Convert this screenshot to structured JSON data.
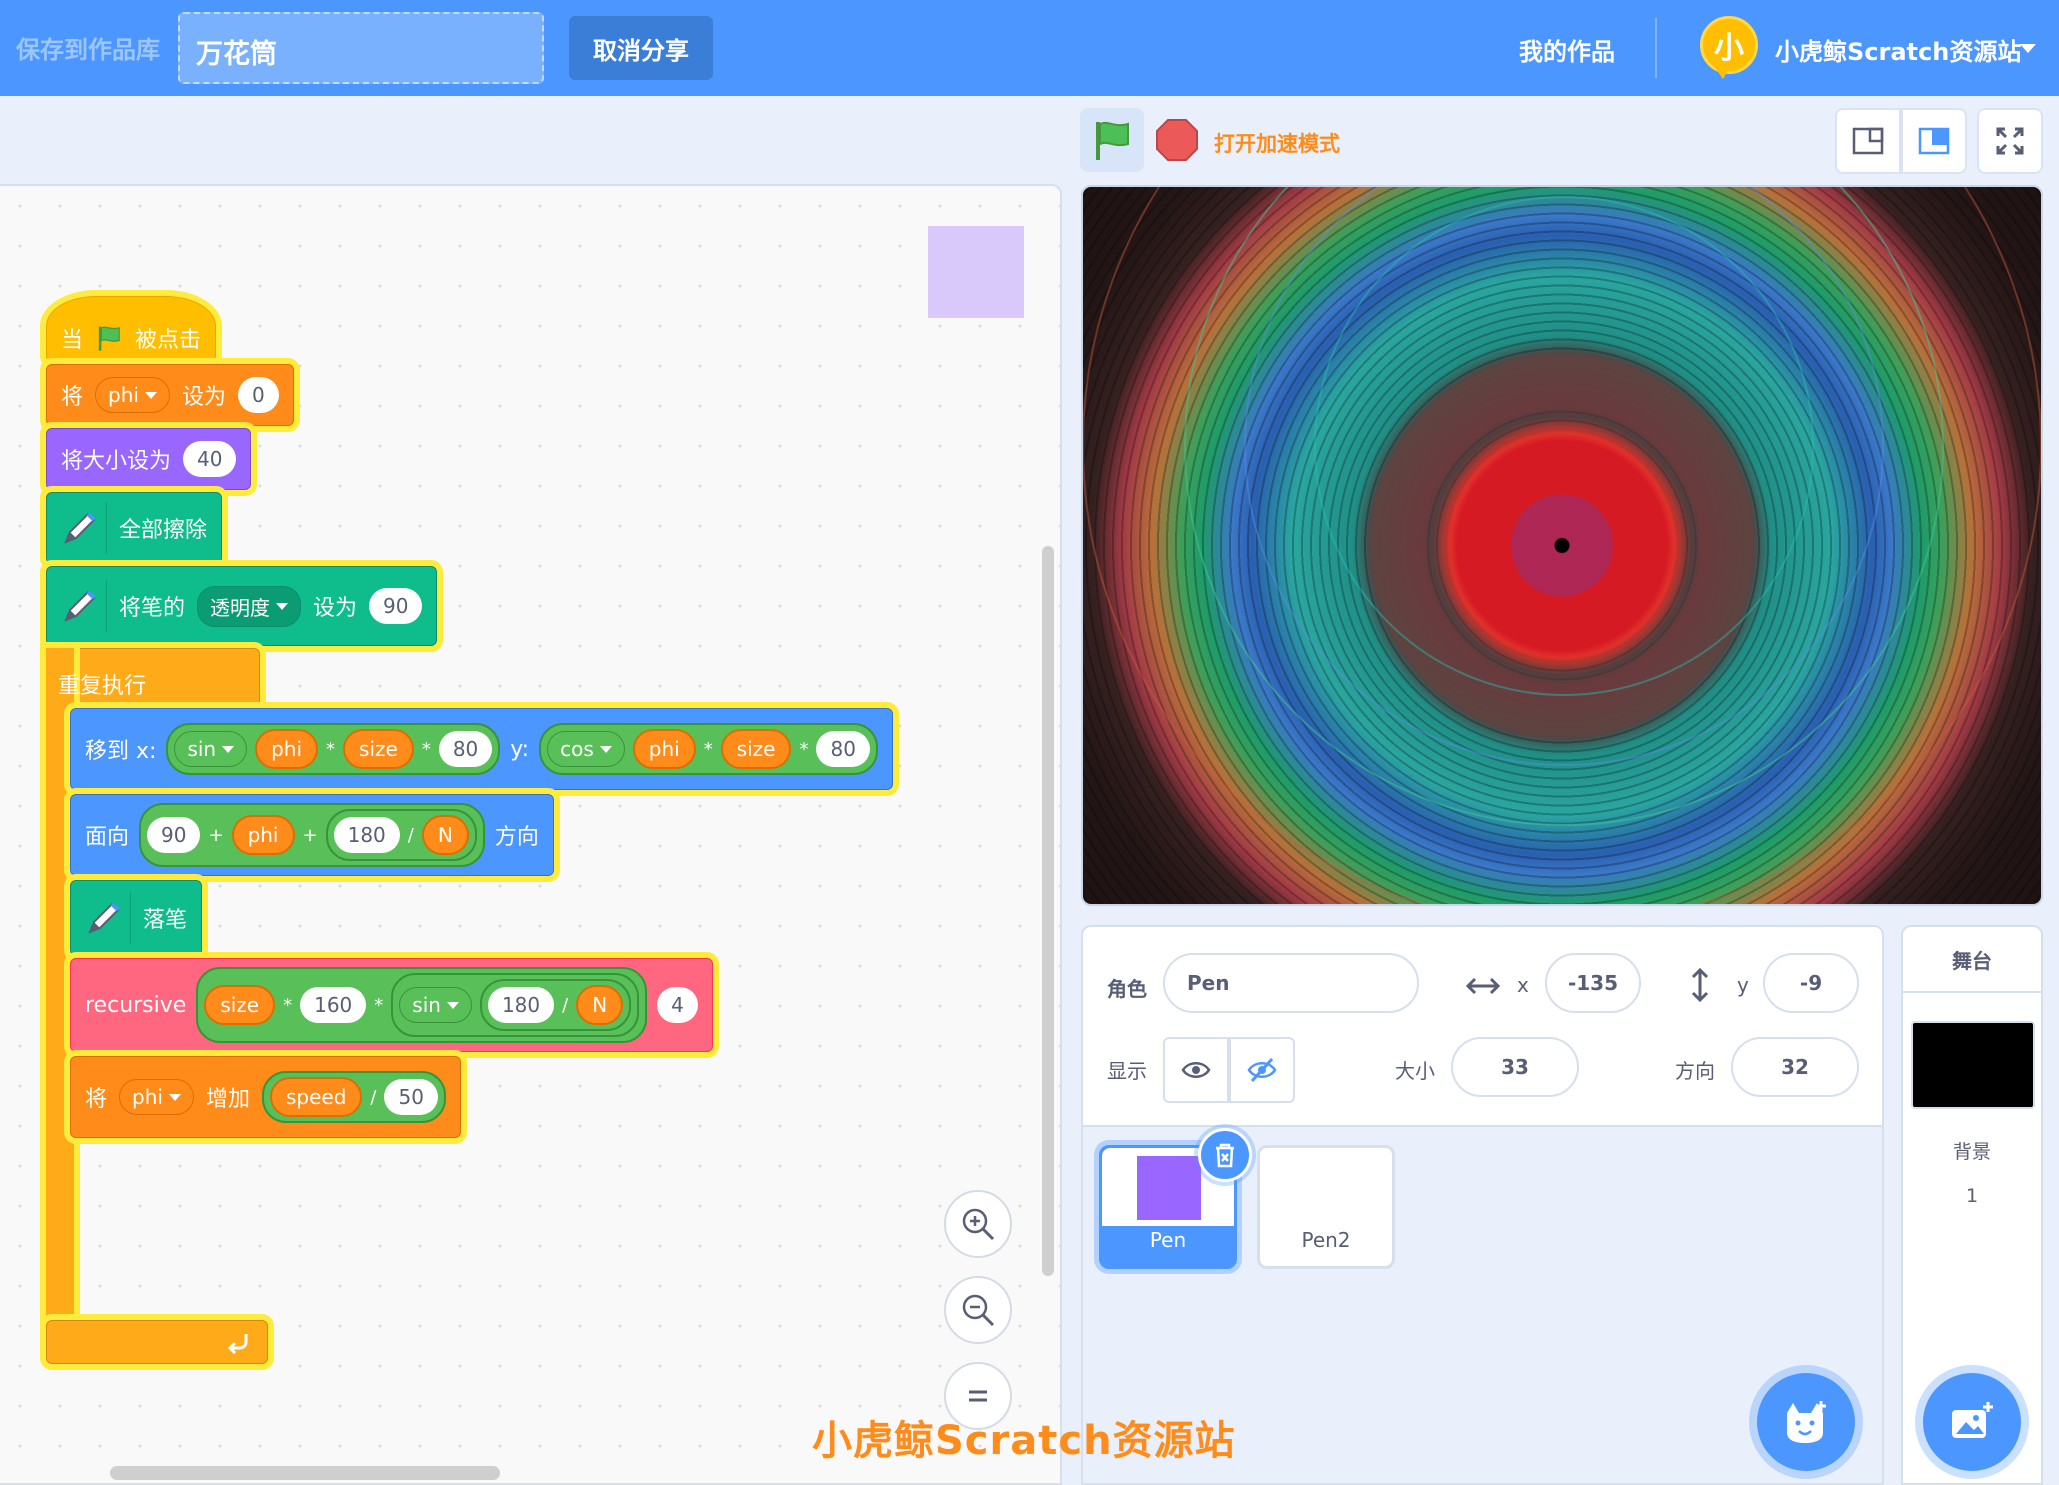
{
  "menu": {
    "save_to_library": "保存到作品库",
    "project_title": "万花筒",
    "unshare": "取消分享",
    "my_works": "我的作品",
    "avatar_char": "小",
    "user_name": "小虎鲸Scratch资源站"
  },
  "stage_header": {
    "turbo": "打开加速模式"
  },
  "blocks": {
    "when_flag_prefix": "当",
    "when_flag_suffix": "被点击",
    "set_var": {
      "label": "将",
      "var": "phi",
      "to": "设为",
      "value": "0"
    },
    "set_size": {
      "label": "将大小设为",
      "value": "40"
    },
    "erase_all": "全部擦除",
    "set_pen": {
      "label": "将笔的",
      "param": "透明度",
      "to": "设为",
      "value": "90"
    },
    "forever": "重复执行",
    "goto": {
      "label": "移到 x:",
      "fn1": "sin",
      "var1": "phi",
      "mul1": "*",
      "size1": "size",
      "mul2": "*",
      "n1": "80",
      "ylabel": "y:",
      "fn2": "cos",
      "var2": "phi",
      "mul3": "*",
      "size2": "size",
      "mul4": "*",
      "n2": "80"
    },
    "point": {
      "label": "面向",
      "n1": "90",
      "plus1": "+",
      "var": "phi",
      "plus2": "+",
      "n2": "180",
      "div": "/",
      "nvar": "N",
      "suffix": "方向"
    },
    "pen_down": "落笔",
    "recursive": {
      "label": "recursive",
      "size": "size",
      "mul1": "*",
      "n1": "160",
      "mul2": "*",
      "fn": "sin",
      "n2": "180",
      "div": "/",
      "nvar": "N",
      "arg": "4"
    },
    "change_var": {
      "label": "将",
      "var": "phi",
      "by": "增加",
      "speed": "speed",
      "div": "/",
      "value": "50"
    }
  },
  "sprite_info": {
    "sprite_label": "角色",
    "sprite_name": "Pen",
    "x_label": "x",
    "x_value": "-135",
    "y_label": "y",
    "y_value": "-9",
    "show_label": "显示",
    "size_label": "大小",
    "size_value": "33",
    "direction_label": "方向",
    "direction_value": "32"
  },
  "sprites": [
    {
      "name": "Pen",
      "selected": true
    },
    {
      "name": "Pen2",
      "selected": false
    }
  ],
  "stage_panel": {
    "title": "舞台",
    "backdrop_label": "背景",
    "backdrop_count": "1"
  },
  "watermark": "小虎鲸Scratch资源站"
}
